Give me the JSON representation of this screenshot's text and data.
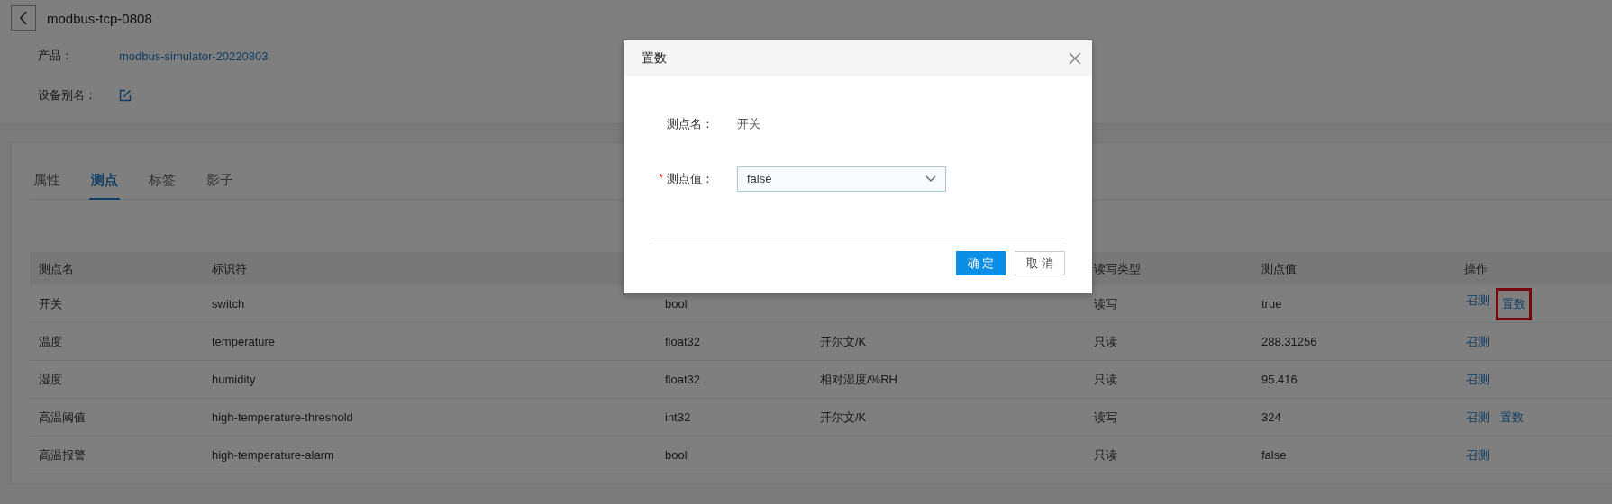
{
  "header": {
    "title": "modbus-tcp-0808"
  },
  "info": [
    {
      "label": "产品：",
      "kind": "link",
      "value": "modbus-simulator-20220803"
    },
    {
      "label": "设备别名：",
      "kind": "edit"
    }
  ],
  "tabs": [
    {
      "label": "属性",
      "selected": false
    },
    {
      "label": "测点",
      "selected": true
    },
    {
      "label": "标签",
      "selected": false
    },
    {
      "label": "影子",
      "selected": false
    }
  ],
  "table": {
    "columns": {
      "name": "测点名",
      "identifier": "标识符",
      "access": "读写类型",
      "value": "测点值",
      "actions": "操作"
    },
    "rows": [
      {
        "name": "开关",
        "identifier": "switch",
        "data_type": "bool",
        "access": "读写",
        "value": "true",
        "actions": [
          {
            "label": "召测",
            "highlighted": false
          },
          {
            "label": "置数",
            "highlighted": true
          }
        ]
      },
      {
        "name": "温度",
        "identifier": "temperature",
        "data_type": "float32",
        "unit": "开尔文/K",
        "access": "只读",
        "value": "288.31256",
        "actions": [
          {
            "label": "召测",
            "highlighted": false
          }
        ]
      },
      {
        "name": "湿度",
        "identifier": "humidity",
        "data_type": "float32",
        "unit": "相对湿度/%RH",
        "access": "只读",
        "value": "95.416",
        "actions": [
          {
            "label": "召测",
            "highlighted": false
          }
        ]
      },
      {
        "name": "高温阈值",
        "identifier": "high-temperature-threshold",
        "data_type": "int32",
        "unit": "开尔文/K",
        "access": "读写",
        "value": "324",
        "actions": [
          {
            "label": "召测",
            "highlighted": false
          },
          {
            "label": "置数",
            "highlighted": false
          }
        ]
      },
      {
        "name": "高温报警",
        "identifier": "high-temperature-alarm",
        "data_type": "bool",
        "access": "只读",
        "value": "false",
        "actions": [
          {
            "label": "召测",
            "highlighted": false
          }
        ]
      }
    ]
  },
  "modal": {
    "title": "置数",
    "required_mark": "*",
    "fields": [
      {
        "kind": "text",
        "label": "测点名：",
        "required": false,
        "value": "开关"
      },
      {
        "kind": "select",
        "label": "测点值：",
        "required": true,
        "value": "false"
      }
    ],
    "buttons": [
      {
        "label": "确 定",
        "kind": "primary"
      },
      {
        "label": "取 消",
        "kind": "default"
      }
    ]
  }
}
